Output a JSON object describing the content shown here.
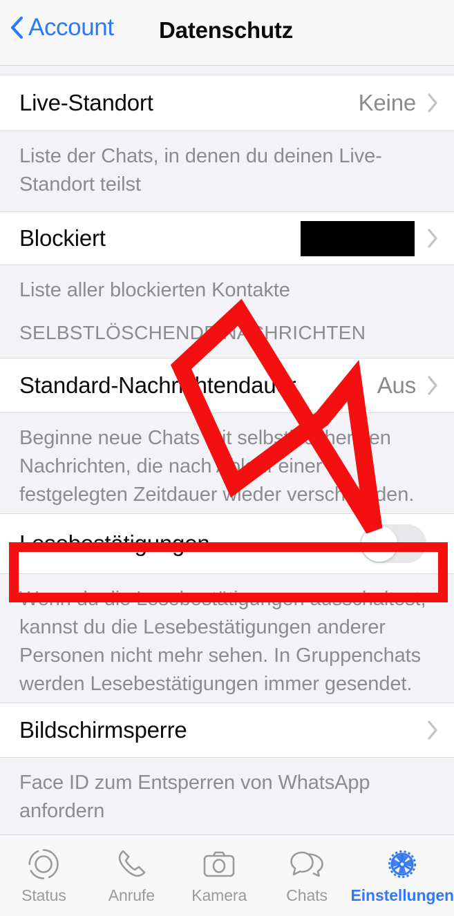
{
  "navbar": {
    "back_label": "Account",
    "title": "Datenschutz",
    "back_icon": "chevron-left-icon",
    "accent_color": "#2b7bf3"
  },
  "rows": {
    "live_location": {
      "title": "Live-Standort",
      "value": "Keine",
      "footer": "Liste der Chats, in denen du deinen Live-Standort teilst"
    },
    "blocked": {
      "title": "Blockiert",
      "value": "",
      "footer": "Liste aller blockierten Kontakte"
    },
    "disappearing_section_header": "SELBSTLÖSCHENDE NACHRICHTEN",
    "default_message_timer": {
      "title": "Standard-Nachrichtendauer",
      "value": "Aus",
      "footer": "Beginne neue Chats mit selbstlöschenden Nachrichten, die nach Ablauf einer festgelegten Zeitdauer wieder verschwinden."
    },
    "read_receipts": {
      "title": "Lesebestätigungen",
      "toggle_state": "off",
      "footer": "Wenn du die Lesebestätigungen ausschaltest, kannst du die Lesebestätigungen anderer Personen nicht mehr sehen. In Gruppenchats werden Lesebestätigungen immer gesendet."
    },
    "screen_lock": {
      "title": "Bildschirmsperre",
      "footer": "Face ID zum Entsperren von WhatsApp anfordern"
    }
  },
  "annotations": {
    "arrow_color": "#f41010",
    "highlight_color": "#f41010",
    "arrow_name": "red-arrow-annotation",
    "highlight_name": "red-highlight-rectangle"
  },
  "tabbar": {
    "items": [
      {
        "label": "Status",
        "icon": "status-rings-icon",
        "active": false
      },
      {
        "label": "Anrufe",
        "icon": "phone-icon",
        "active": false
      },
      {
        "label": "Kamera",
        "icon": "camera-icon",
        "active": false
      },
      {
        "label": "Chats",
        "icon": "chat-bubbles-icon",
        "active": false
      },
      {
        "label": "Einstellungen",
        "icon": "gear-icon",
        "active": true
      }
    ],
    "active_color": "#3478f6",
    "inactive_color": "#9a9a9e"
  }
}
